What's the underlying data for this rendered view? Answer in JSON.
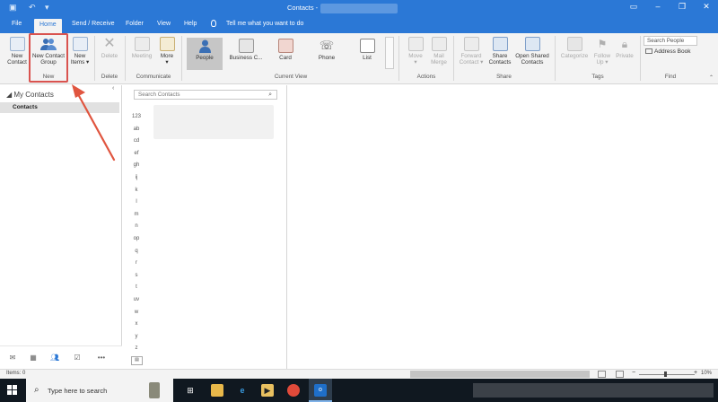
{
  "window": {
    "title": "Contacts -",
    "controls": [
      "restore-icon",
      "minimize-icon",
      "maximize-icon",
      "close-icon"
    ]
  },
  "tabs": {
    "file": "File",
    "home": "Home",
    "send_receive": "Send / Receive",
    "folder": "Folder",
    "view": "View",
    "help": "Help",
    "tell_me": "Tell me what you want to do"
  },
  "ribbon": {
    "new_contact": "New Contact",
    "new_contact_line1": "New",
    "new_contact_line2": "Contact",
    "new_group_line1": "New Contact",
    "new_group_line2": "Group",
    "new_items_line1": "New",
    "new_items_line2": "Items",
    "delete": "Delete",
    "group_new": "New",
    "group_delete": "Delete",
    "meeting": "Meeting",
    "more": "More",
    "group_communicate": "Communicate",
    "view_people": "People",
    "view_business": "Business C...",
    "view_card": "Card",
    "view_phone": "Phone",
    "view_list": "List",
    "group_current_view": "Current View",
    "move": "Move",
    "mail_merge_line1": "Mail",
    "mail_merge_line2": "Merge",
    "group_actions": "Actions",
    "forward_line1": "Forward",
    "forward_line2": "Contact",
    "share_line1": "Share",
    "share_line2": "Contacts",
    "open_shared_line1": "Open Shared",
    "open_shared_line2": "Contacts",
    "group_share": "Share",
    "categorize": "Categorize",
    "follow_line1": "Follow",
    "follow_line2": "Up",
    "private": "Private",
    "group_tags": "Tags",
    "search_people": "Search People",
    "address_book": "Address Book",
    "group_find": "Find"
  },
  "nav": {
    "my_contacts": "My Contacts",
    "contacts": "Contacts"
  },
  "list": {
    "search_placeholder": "Search Contacts",
    "alphabet": [
      "123",
      "ab",
      "cd",
      "ef",
      "gh",
      "ij",
      "k",
      "l",
      "m",
      "n",
      "op",
      "q",
      "r",
      "s",
      "t",
      "uv",
      "w",
      "x",
      "y",
      "z"
    ]
  },
  "status": {
    "items": "Items: 0",
    "zoom": "10%"
  },
  "taskbar": {
    "search_text": "Type here to search"
  },
  "colors": {
    "accent": "#2b78d6",
    "highlight": "#d9534f",
    "taskbar": "#101820"
  }
}
